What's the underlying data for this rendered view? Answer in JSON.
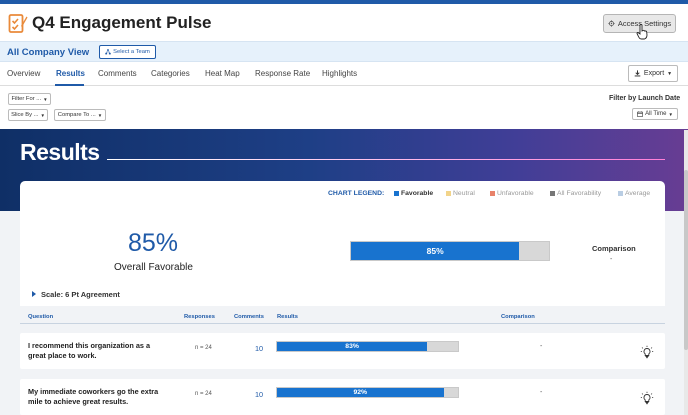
{
  "header": {
    "title": "Q4 Engagement Pulse",
    "access_settings_label": "Access Settings"
  },
  "subheader": {
    "view_name": "All Company View",
    "select_team_label": "Select a Team"
  },
  "tabs": [
    {
      "label": "Overview",
      "active": false
    },
    {
      "label": "Results",
      "active": true
    },
    {
      "label": "Comments",
      "active": false
    },
    {
      "label": "Categories",
      "active": false
    },
    {
      "label": "Heat Map",
      "active": false
    },
    {
      "label": "Response Rate",
      "active": false
    },
    {
      "label": "Highlights",
      "active": false
    }
  ],
  "export_label": "Export",
  "filters": {
    "filter_for": "Filter For ...",
    "slice_by": "Slice By ...",
    "compare_to": "Compare To ...",
    "launch_label": "Filter by Launch Date",
    "launch_value": "All Time"
  },
  "banner": {
    "title": "Results"
  },
  "legend": {
    "title": "CHART LEGEND:",
    "items": [
      {
        "label": "Favorable",
        "color": "#1873cf"
      },
      {
        "label": "Neutral",
        "color": "#f2d48a"
      },
      {
        "label": "Unfavorable",
        "color": "#e8826a"
      },
      {
        "label": "All Favorability",
        "color": "#777777"
      },
      {
        "label": "Average",
        "color": "#b9cde3"
      }
    ]
  },
  "summary": {
    "percent": "85%",
    "label": "Overall Favorable",
    "bar_value": 85,
    "bar_label": "85%",
    "comparison_label": "Comparison",
    "comparison_value": "-"
  },
  "scale_label": "Scale: 6 Pt Agreement",
  "columns": {
    "question": "Question",
    "responses": "Responses",
    "comments": "Comments",
    "results": "Results",
    "comparison": "Comparison"
  },
  "questions": [
    {
      "text": "I recommend this organization as a great place to work.",
      "responses": "n = 24",
      "comments": "10",
      "favorable": 83,
      "favorable_label": "83%",
      "comparison": "-"
    },
    {
      "text": "My immediate coworkers go the extra mile to achieve great results.",
      "responses": "n = 24",
      "comments": "10",
      "favorable": 92,
      "favorable_label": "92%",
      "comparison": "-"
    }
  ],
  "colors": {
    "brand": "#1f5aa8",
    "favorable": "#1873cf",
    "logo": "#e98a3a"
  }
}
